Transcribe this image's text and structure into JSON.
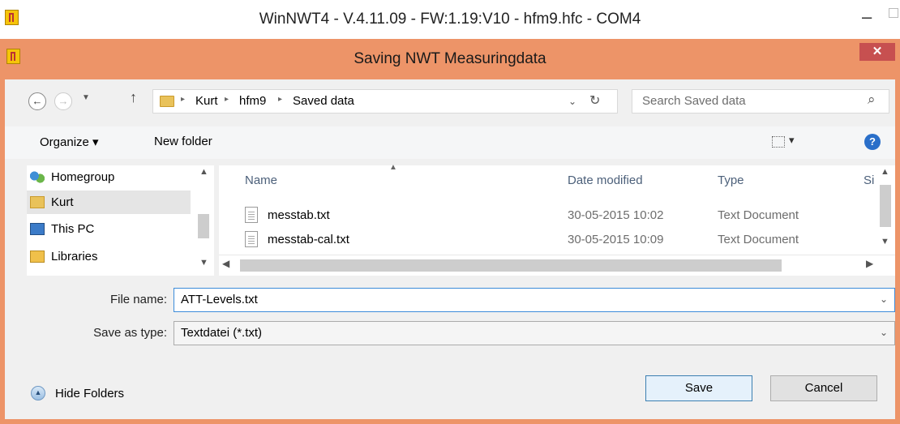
{
  "app": {
    "title": "WinNWT4 - V.4.11.09 - FW:1.19:V10 - hfm9.hfc - COM4",
    "minimize_glyph": "–"
  },
  "dialog": {
    "title": "Saving NWT Measuringdata",
    "close_glyph": "✕",
    "accent_color": "#ed9468"
  },
  "address": {
    "breadcrumbs": [
      "Kurt",
      "hfm9",
      "Saved data"
    ],
    "separator": "▸",
    "search_placeholder": "Search Saved data"
  },
  "toolbar": {
    "organize_label": "Organize ▾",
    "new_folder_label": "New folder",
    "view_glyph": "▾"
  },
  "nav": {
    "items": [
      {
        "label": "Homegroup",
        "icon": "homegroup-icon"
      },
      {
        "label": "Kurt",
        "icon": "user-folder-icon"
      },
      {
        "label": "This PC",
        "icon": "computer-icon"
      },
      {
        "label": "Libraries",
        "icon": "libraries-icon"
      }
    ]
  },
  "filelist": {
    "columns": [
      "Name",
      "Date modified",
      "Type",
      "Si"
    ],
    "rows": [
      {
        "name": "messtab.txt",
        "date": "30-05-2015 10:02",
        "type": "Text Document"
      },
      {
        "name": "messtab-cal.txt",
        "date": "30-05-2015 10:09",
        "type": "Text Document"
      }
    ]
  },
  "form": {
    "filename_label": "File name:",
    "filename_value": "ATT-Levels.txt",
    "savetype_label": "Save as type:",
    "savetype_value": "Textdatei (*.txt)"
  },
  "footer": {
    "hide_folders_label": "Hide Folders",
    "save_label": "Save",
    "cancel_label": "Cancel"
  }
}
